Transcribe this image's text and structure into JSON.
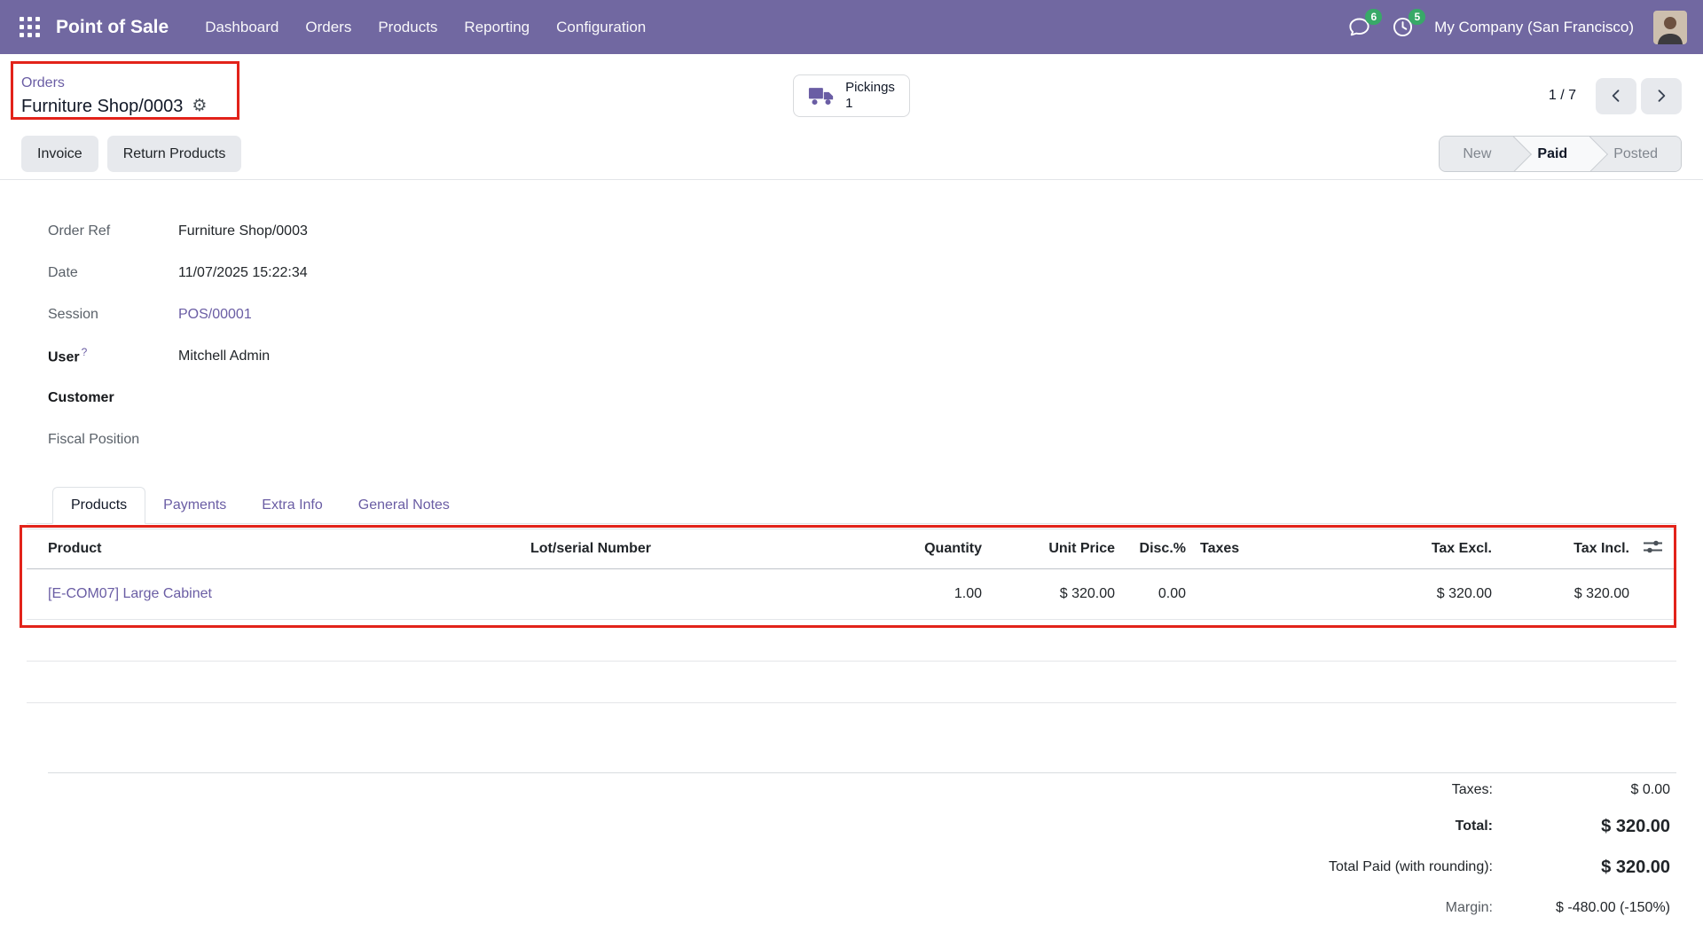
{
  "colors": {
    "navbar_bg": "#7168a1",
    "link": "#6a5da4",
    "badge_bg": "#38a968",
    "annotation": "#e2231a"
  },
  "navbar": {
    "app_name": "Point of Sale",
    "menu": [
      "Dashboard",
      "Orders",
      "Products",
      "Reporting",
      "Configuration"
    ],
    "messages_badge": "6",
    "activities_badge": "5",
    "company": "My Company (San Francisco)"
  },
  "breadcrumb": {
    "parent": "Orders",
    "current": "Furniture Shop/0003"
  },
  "stat_button": {
    "label": "Pickings",
    "value": "1"
  },
  "pager": {
    "counter": "1 / 7"
  },
  "buttons": {
    "invoice": "Invoice",
    "return_products": "Return Products"
  },
  "statusbar": {
    "states": [
      "New",
      "Paid",
      "Posted"
    ],
    "active": "Paid"
  },
  "form": {
    "order_ref": {
      "label": "Order Ref",
      "value": "Furniture Shop/0003"
    },
    "date": {
      "label": "Date",
      "value": "11/07/2025 15:22:34"
    },
    "session": {
      "label": "Session",
      "value": "POS/00001"
    },
    "user": {
      "label": "User",
      "help": "?",
      "value": "Mitchell Admin"
    },
    "customer": {
      "label": "Customer",
      "value": ""
    },
    "fiscal_position": {
      "label": "Fiscal Position",
      "value": ""
    }
  },
  "tabs": [
    "Products",
    "Payments",
    "Extra Info",
    "General Notes"
  ],
  "products_table": {
    "columns": [
      "Product",
      "Lot/serial Number",
      "Quantity",
      "Unit Price",
      "Disc.%",
      "Taxes",
      "Tax Excl.",
      "Tax Incl."
    ],
    "rows": [
      {
        "product": "[E-COM07] Large Cabinet",
        "lot_serial": "",
        "quantity": "1.00",
        "unit_price": "$ 320.00",
        "disc": "0.00",
        "taxes": "",
        "tax_excl": "$ 320.00",
        "tax_incl": "$ 320.00"
      }
    ]
  },
  "totals": {
    "taxes": {
      "label": "Taxes:",
      "value": "$ 0.00"
    },
    "total": {
      "label": "Total:",
      "value": "$ 320.00"
    },
    "total_paid": {
      "label": "Total Paid (with rounding):",
      "value": "$ 320.00"
    },
    "margin": {
      "label": "Margin:",
      "value": "$ -480.00 (-150%)"
    }
  }
}
